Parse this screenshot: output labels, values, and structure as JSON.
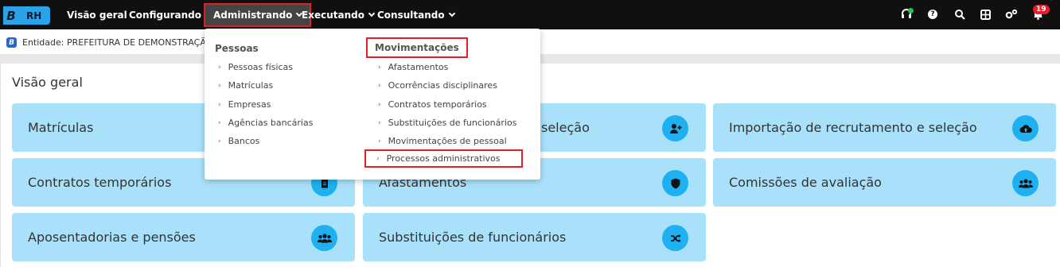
{
  "app": {
    "logo_letter": "B",
    "logo_text": "RH"
  },
  "nav": [
    {
      "label": "Visão geral"
    },
    {
      "label": "Configurando"
    },
    {
      "label": "Administrando"
    },
    {
      "label": "Executando"
    },
    {
      "label": "Consultando"
    }
  ],
  "top_icons": [
    "headset-icon",
    "help-icon",
    "search-icon",
    "grid-icon",
    "gears-icon",
    "notification-icon"
  ],
  "notifications_count": "19",
  "entity": {
    "icon_letter": "B",
    "label": "Entidade: PREFEITURA DE DEMONSTRAÇÃO"
  },
  "page": {
    "title": "Visão geral"
  },
  "cards": [
    {
      "label": "Matrículas",
      "icon": "id-card-icon"
    },
    {
      "label": "seleção",
      "icon": "user-plus-icon"
    },
    {
      "label": "Importação de recrutamento e seleção",
      "icon": "cloud-upload-icon"
    },
    {
      "label": "Contratos temporários",
      "icon": "document-icon"
    },
    {
      "label": "Afastamentos",
      "icon": "shield-icon"
    },
    {
      "label": "Comissões de avaliação",
      "icon": "users-icon"
    },
    {
      "label": "Aposentadorias e pensões",
      "icon": "users-icon"
    },
    {
      "label": "Substituições de funcionários",
      "icon": "shuffle-icon"
    }
  ],
  "menu": {
    "pessoas": {
      "title": "Pessoas",
      "items": [
        "Pessoas físicas",
        "Matrículas",
        "Empresas",
        "Agências bancárias",
        "Bancos"
      ]
    },
    "movimentacoes": {
      "title": "Movimentações",
      "items": [
        "Afastamentos",
        "Ocorrências disciplinares",
        "Contratos temporários",
        "Substituições de funcionários",
        "Movimentações de pessoal",
        "Processos administrativos"
      ]
    }
  },
  "colors": {
    "topbar": "#101010",
    "card": "#a9e1fb",
    "card_icon": "#1eb0f0",
    "highlight": "#e0202a",
    "logo": "#2ba3ea"
  }
}
